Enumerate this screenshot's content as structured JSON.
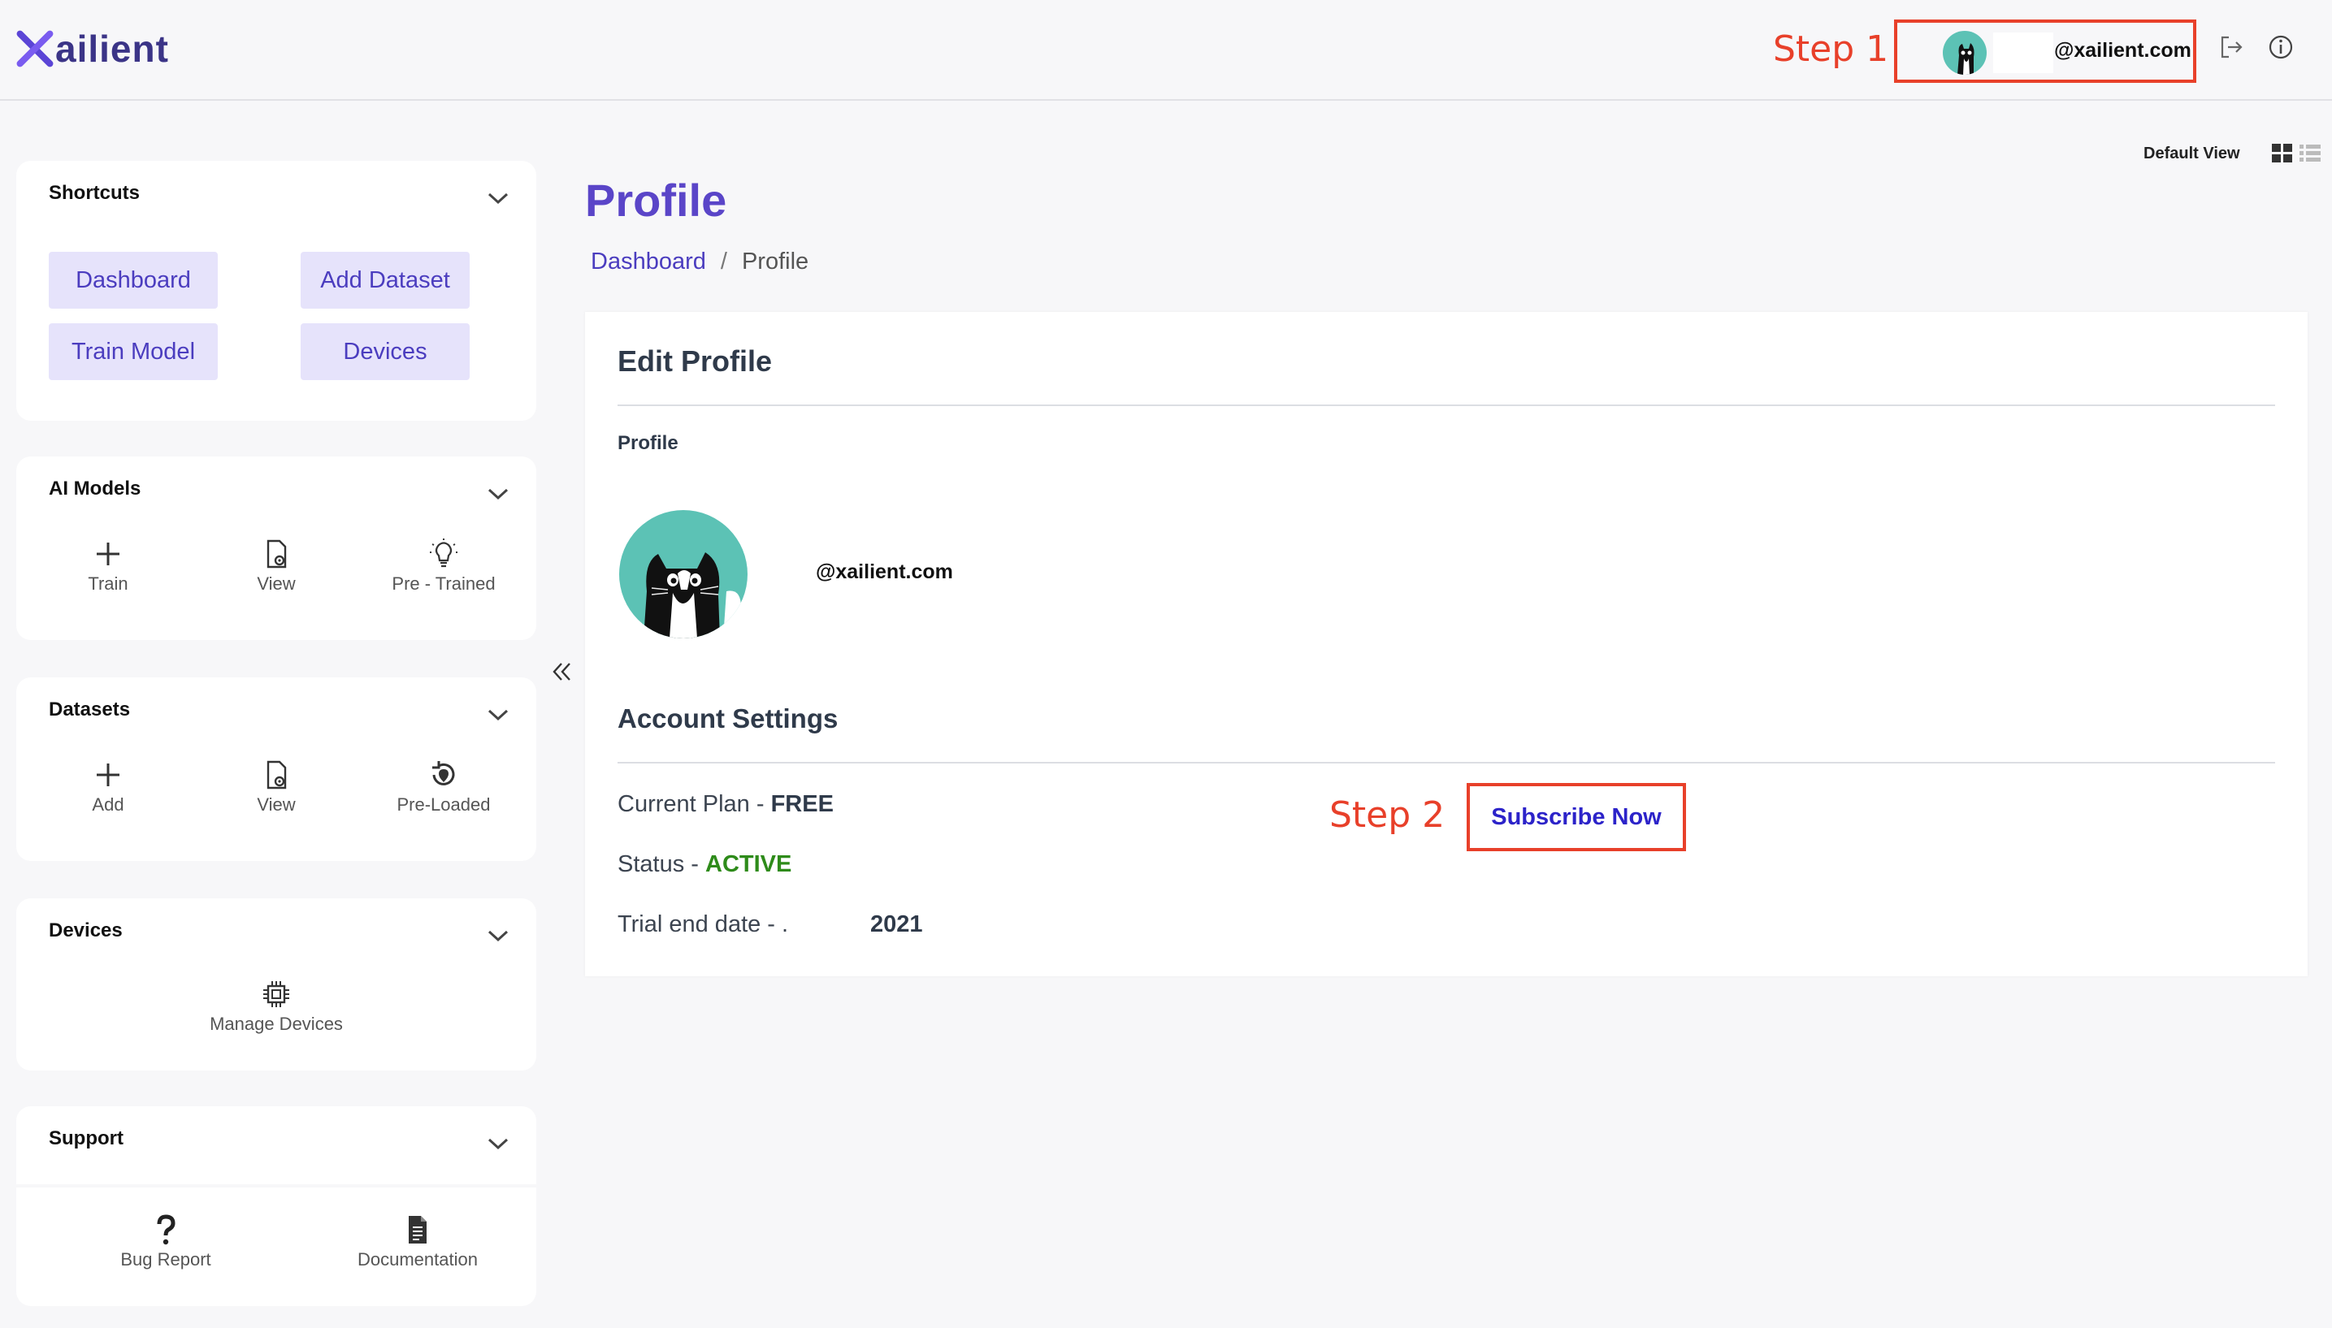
{
  "app": {
    "logo_text": "ailient",
    "brand_color": "#3b3487",
    "accent_color": "#5a45c8",
    "annotation_color": "#e8402a"
  },
  "header": {
    "step1_label": "Step 1",
    "user_email": "@xailient.com",
    "logout_icon": "logout-icon",
    "info_icon": "info-icon"
  },
  "view": {
    "label": "Default View",
    "grid_icon": "grid-view-icon",
    "list_icon": "list-view-icon"
  },
  "sidebar": {
    "shortcuts": {
      "title": "Shortcuts",
      "buttons": [
        "Dashboard",
        "Add Dataset",
        "Train Model",
        "Devices"
      ]
    },
    "ai_models": {
      "title": "AI Models",
      "items": [
        "Train",
        "View",
        "Pre - Trained"
      ]
    },
    "datasets": {
      "title": "Datasets",
      "items": [
        "Add",
        "View",
        "Pre-Loaded"
      ]
    },
    "devices": {
      "title": "Devices",
      "items": [
        "Manage Devices"
      ]
    },
    "support": {
      "title": "Support",
      "items": [
        "Bug Report",
        "Documentation"
      ]
    }
  },
  "main": {
    "page_title": "Profile",
    "breadcrumb": [
      "Dashboard",
      "/",
      "Profile"
    ],
    "panel": {
      "title": "Edit Profile",
      "profile_label": "Profile",
      "email": "@xailient.com",
      "account_title": "Account Settings",
      "plan_label": "Current Plan - ",
      "plan_value": "FREE",
      "status_label": "Status - ",
      "status_value": "ACTIVE",
      "trial_label": "Trial end date - .",
      "trial_value": "2021",
      "step2_label": "Step 2",
      "subscribe_label": "Subscribe Now"
    }
  }
}
